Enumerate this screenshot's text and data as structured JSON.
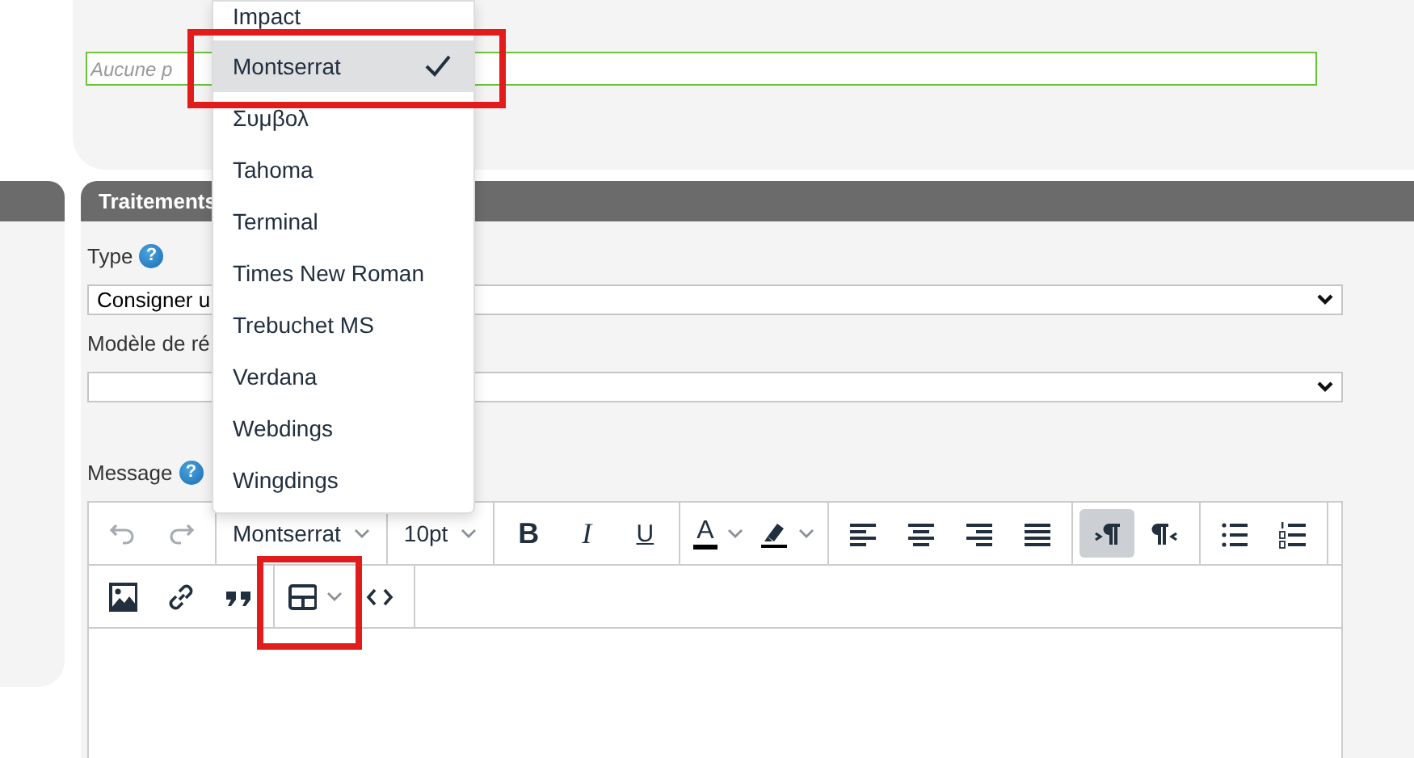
{
  "attachment_field": {
    "placeholder": "Aucune p"
  },
  "section": {
    "title": "Traitements"
  },
  "fields": [
    {
      "label": "Type",
      "help": "?",
      "value": "Consigner u"
    },
    {
      "label": "Modèle de ré"
    }
  ],
  "message": {
    "label": "Message",
    "help": "?"
  },
  "toolbar_rows": [
    [
      [
        {
          "kind": "undo",
          "disabled": true
        },
        {
          "kind": "redo",
          "disabled": true
        }
      ],
      [
        {
          "kind": "select",
          "label": "Montserrat"
        }
      ],
      [
        {
          "kind": "select",
          "label": "10pt"
        }
      ],
      [
        {
          "kind": "bold",
          "label": "B"
        },
        {
          "kind": "italic",
          "label": "I"
        },
        {
          "kind": "underline",
          "label": "U"
        }
      ],
      [
        {
          "kind": "textcolor",
          "label": "A"
        },
        {
          "kind": "highlight"
        }
      ],
      [
        {
          "kind": "alignleft"
        },
        {
          "kind": "aligncenter"
        },
        {
          "kind": "alignright"
        },
        {
          "kind": "justify"
        }
      ],
      [
        {
          "kind": "ltr",
          "selected": true
        },
        {
          "kind": "rtl",
          "selected": false
        }
      ],
      [
        {
          "kind": "bullets"
        },
        {
          "kind": "numbers"
        }
      ],
      []
    ],
    [
      [
        {
          "kind": "image"
        },
        {
          "kind": "link"
        },
        {
          "kind": "quote"
        }
      ],
      [
        {
          "kind": "table",
          "highlighted": true
        },
        {
          "kind": "code"
        }
      ]
    ]
  ],
  "font_menu": {
    "items": [
      {
        "label": "Impact",
        "selected": false,
        "highlighted": false
      },
      {
        "label": "Montserrat",
        "selected": true,
        "highlighted": true
      },
      {
        "label": "Συμβολ",
        "selected": false,
        "highlighted": false
      },
      {
        "label": "Tahoma",
        "selected": false,
        "highlighted": false
      },
      {
        "label": "Terminal",
        "selected": false,
        "highlighted": false
      },
      {
        "label": "Times New Roman",
        "selected": false,
        "highlighted": false
      },
      {
        "label": "Trebuchet MS",
        "selected": false,
        "highlighted": false
      },
      {
        "label": "Verdana",
        "selected": false,
        "highlighted": false
      },
      {
        "label": "Webdings",
        "selected": false,
        "highlighted": false
      },
      {
        "label": "Wingdings",
        "selected": false,
        "highlighted": false
      }
    ]
  }
}
